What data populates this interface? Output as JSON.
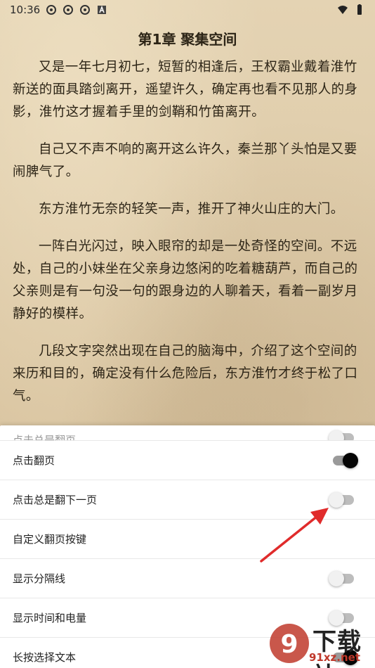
{
  "status": {
    "time": "10:36",
    "left_icons": [
      "app-notification-icon",
      "app-notification-icon",
      "app-notification-icon",
      "a-badge-icon"
    ],
    "right_icons": [
      "wifi-icon",
      "battery-icon"
    ]
  },
  "reader": {
    "chapter_title": "第1章 聚集空间",
    "paragraphs": [
      "又是一年七月初七，短暂的相逢后，王权霸业戴着淮竹新送的面具踏剑离开，遥望许久，确定再也看不见那人的身影，淮竹这才握着手里的剑鞘和竹笛离开。",
      "自己又不声不响的离开这么许久，秦兰那丫头怕是又要闹脾气了。",
      "东方淮竹无奈的轻笑一声，推开了神火山庄的大门。",
      "一阵白光闪过，映入眼帘的却是一处奇怪的空间。不远处，自己的小妹坐在父亲身边悠闲的吃着糖葫芦，而自己的父亲则是有一句没一句的跟身边的人聊着天，看着一副岁月静好的模样。",
      "几段文字突然出现在自己的脑海中，介绍了这个空间的来历和目的，确定没有什么危险后，东方淮竹才终于松了口气。"
    ]
  },
  "settings": {
    "items": [
      {
        "label": "点击总是翻页",
        "toggle": "off"
      },
      {
        "label": "点击翻页",
        "toggle": "on"
      },
      {
        "label": "点击总是翻下一页",
        "toggle": "off"
      },
      {
        "label": "自定义翻页按键",
        "toggle": "none"
      },
      {
        "label": "显示分隔线",
        "toggle": "off"
      },
      {
        "label": "显示时间和电量",
        "toggle": "off"
      },
      {
        "label": "长按选择文本",
        "toggle": "on"
      }
    ]
  },
  "watermark": {
    "big_text": "下载站",
    "small_text": "91xz.net",
    "logo_text": "9"
  },
  "colors": {
    "arrow": "#e02b2b",
    "toggle_on_knob": "#050505",
    "toggle_off_knob": "#f1f1f1",
    "paper": "#dcc8a5"
  }
}
